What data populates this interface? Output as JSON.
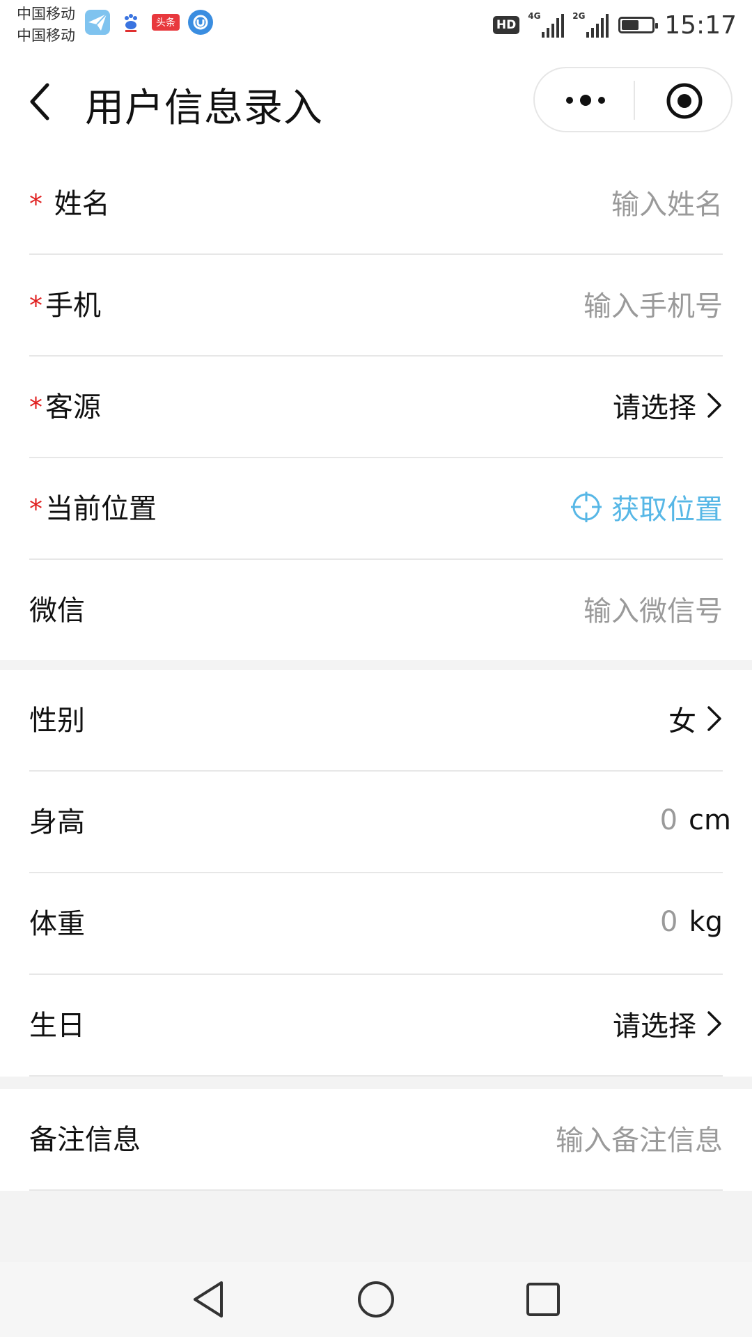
{
  "status_bar": {
    "carrier_1": "中国移动",
    "carrier_2": "中国移动",
    "hd": "HD",
    "net_1": "4G",
    "net_2": "2G",
    "time": "15:17",
    "battery_level": 0.6,
    "app_icons": [
      "paper-plane-icon",
      "baidu-icon",
      "toutiao-icon",
      "uc-icon"
    ],
    "toutiao_label": "头条"
  },
  "nav": {
    "title": "用户信息录入"
  },
  "required_mark": "*",
  "form": {
    "name": {
      "label": "姓名",
      "placeholder": "输入姓名"
    },
    "phone": {
      "label": "手机",
      "placeholder": "输入手机号"
    },
    "source": {
      "label": "客源",
      "value": "请选择"
    },
    "location": {
      "label": "当前位置",
      "action": "获取位置"
    },
    "wechat": {
      "label": "微信",
      "placeholder": "输入微信号"
    },
    "gender": {
      "label": "性别",
      "value": "女"
    },
    "height": {
      "label": "身高",
      "value": "0",
      "unit": "cm"
    },
    "weight": {
      "label": "体重",
      "value": "0",
      "unit": "kg"
    },
    "birthday": {
      "label": "生日",
      "value": "请选择"
    },
    "remark": {
      "label": "备注信息",
      "placeholder": "输入备注信息"
    }
  },
  "colors": {
    "accent": "#57b7e6",
    "required": "#e02020",
    "placeholder": "#9a9a9a",
    "background": "#f3f3f3"
  }
}
